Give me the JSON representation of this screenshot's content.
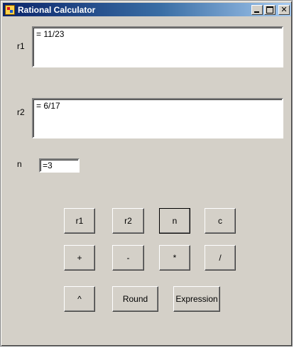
{
  "window": {
    "title": "Rational Calculator",
    "controls": {
      "minimize": "minimize-icon",
      "maximize": "maximize-icon",
      "close": "close-icon"
    }
  },
  "fields": {
    "r1": {
      "label": "r1",
      "value": "= 11/23"
    },
    "r2": {
      "label": "r2",
      "value": "= 6/17"
    },
    "n": {
      "label": "n",
      "value": "=3"
    }
  },
  "buttons": {
    "r1": "r1",
    "r2": "r2",
    "n": "n",
    "c": "c",
    "plus": "+",
    "minus": "-",
    "times": "*",
    "divide": "/",
    "power": "^",
    "round": "Round",
    "expression": "Expression"
  },
  "colors": {
    "face": "#d4d0c8",
    "title_gradient_start": "#0a246a",
    "title_gradient_end": "#a6caf0"
  }
}
